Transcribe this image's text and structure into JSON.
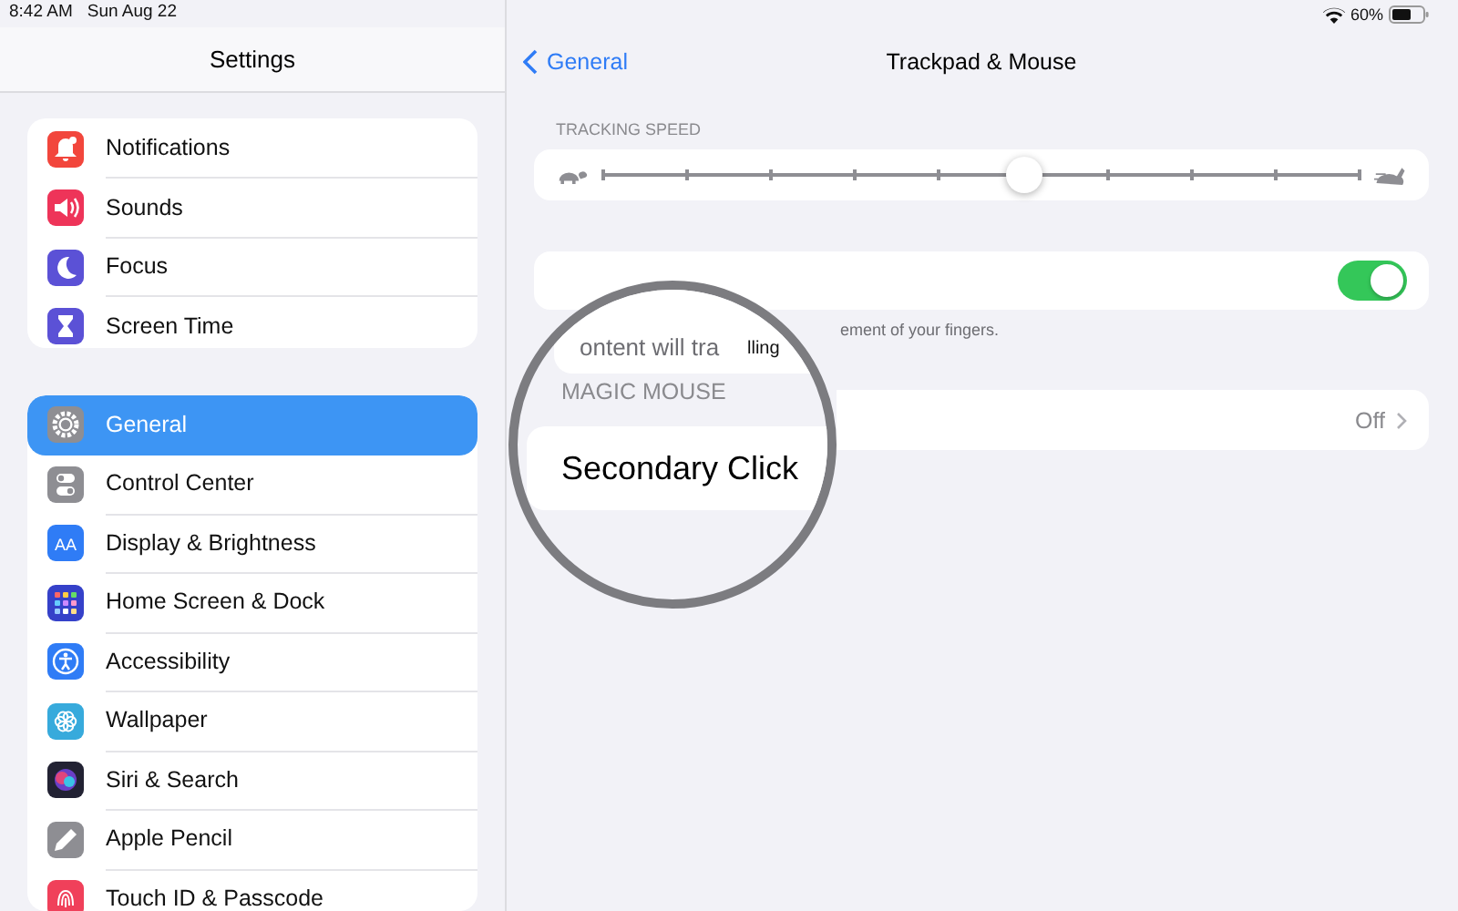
{
  "status_bar": {
    "time": "8:42 AM",
    "date": "Sun Aug 22",
    "battery": "60%"
  },
  "sidebar": {
    "title": "Settings",
    "groups": [
      {
        "items": [
          {
            "label": "Notifications",
            "kind": "bell",
            "color": "#f2463c",
            "selected": false
          },
          {
            "label": "Sounds",
            "kind": "speaker",
            "color": "#ee3459",
            "selected": false
          },
          {
            "label": "Focus",
            "kind": "moon",
            "color": "#5b51d6",
            "selected": false
          },
          {
            "label": "Screen Time",
            "kind": "hourglass",
            "color": "#5b51d6",
            "selected": false
          }
        ]
      },
      {
        "items": [
          {
            "label": "General",
            "kind": "gear",
            "color": "#8e8e93",
            "selected": true
          },
          {
            "label": "Control Center",
            "kind": "switches",
            "color": "#8e8e93",
            "selected": false
          },
          {
            "label": "Display & Brightness",
            "kind": "letters",
            "glyph": "AA",
            "color": "#2f7cf6",
            "selected": false
          },
          {
            "label": "Home Screen & Dock",
            "kind": "grid",
            "color": "#3541c9",
            "selected": false
          },
          {
            "label": "Accessibility",
            "kind": "person",
            "color": "#2f7cf6",
            "selected": false
          },
          {
            "label": "Wallpaper",
            "kind": "flower",
            "color": "#37aadc",
            "selected": false
          },
          {
            "label": "Siri & Search",
            "kind": "orb",
            "color": "#222233",
            "selected": false
          },
          {
            "label": "Apple Pencil",
            "kind": "pencil",
            "color": "#8e8e93",
            "selected": false
          },
          {
            "label": "Touch ID & Passcode",
            "kind": "fingerprint",
            "color": "#f0405a",
            "selected": false
          }
        ]
      }
    ]
  },
  "detail": {
    "back": "General",
    "title": "Trackpad & Mouse",
    "tracking_speed": {
      "header": "TRACKING SPEED",
      "level": 0.556
    },
    "scroll_row": {
      "on": true,
      "footer": "ement of your fingers."
    },
    "secondary_click": {
      "value": "Off"
    }
  },
  "magnifier": {
    "row_text": "ontent will tra",
    "row_text_end": "lling",
    "header": "MAGIC MOUSE",
    "label": "Secondary Click"
  }
}
